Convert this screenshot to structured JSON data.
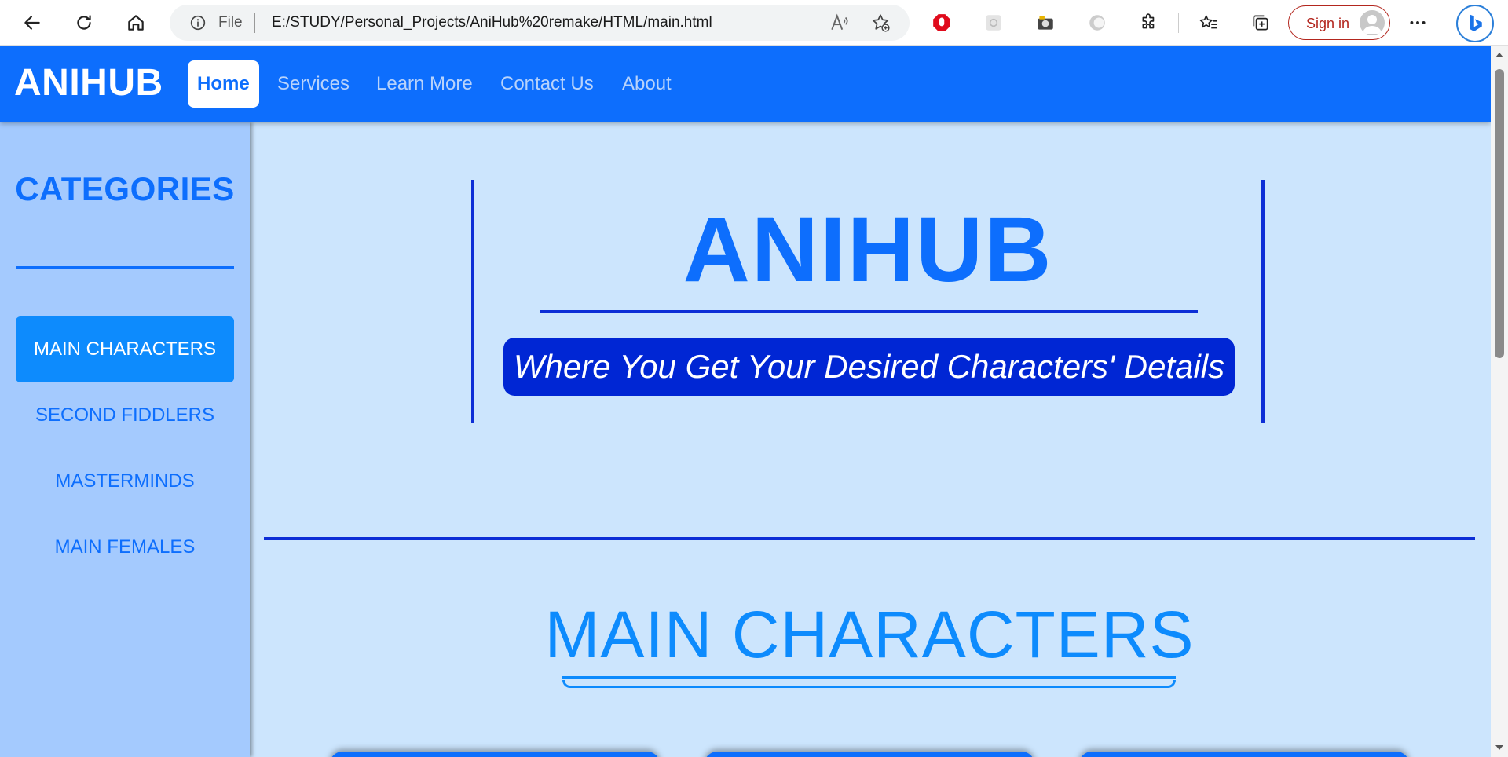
{
  "browser": {
    "url_prefix": "File",
    "url": "E:/STUDY/Personal_Projects/AniHub%20remake/HTML/main.html",
    "sign_in_label": "Sign in",
    "icons": [
      "back-arrow-icon",
      "refresh-icon",
      "home-icon",
      "info-icon",
      "read-aloud-icon",
      "add-favorite-icon",
      "opera-extension-icon",
      "extension-icon",
      "camera-extension-icon",
      "extension-icon",
      "puzzle-icon",
      "favorites-icon",
      "collections-icon",
      "more-icon",
      "bing-icon"
    ]
  },
  "navbar": {
    "brand": "ANIHUB",
    "links": [
      {
        "label": "Home",
        "active": true
      },
      {
        "label": "Services"
      },
      {
        "label": "Learn More"
      },
      {
        "label": "Contact Us"
      },
      {
        "label": "About"
      }
    ]
  },
  "sidebar": {
    "title": "CATEGORIES",
    "items": [
      {
        "label": "MAIN CHARACTERS",
        "active": true
      },
      {
        "label": "SECOND FIDDLERS"
      },
      {
        "label": "MASTERMINDS"
      },
      {
        "label": "MAIN FEMALES"
      }
    ]
  },
  "hero": {
    "title": "ANIHUB",
    "tagline": "Where You Get Your Desired Characters' Details"
  },
  "section": {
    "title": "MAIN CHARACTERS"
  },
  "colors": {
    "primary": "#0d6efd",
    "page_background": "#cce5fd",
    "sidebar_background": "#a4cafe",
    "accent_dark": "#0026d4",
    "active_item": "#0d8bfd"
  }
}
